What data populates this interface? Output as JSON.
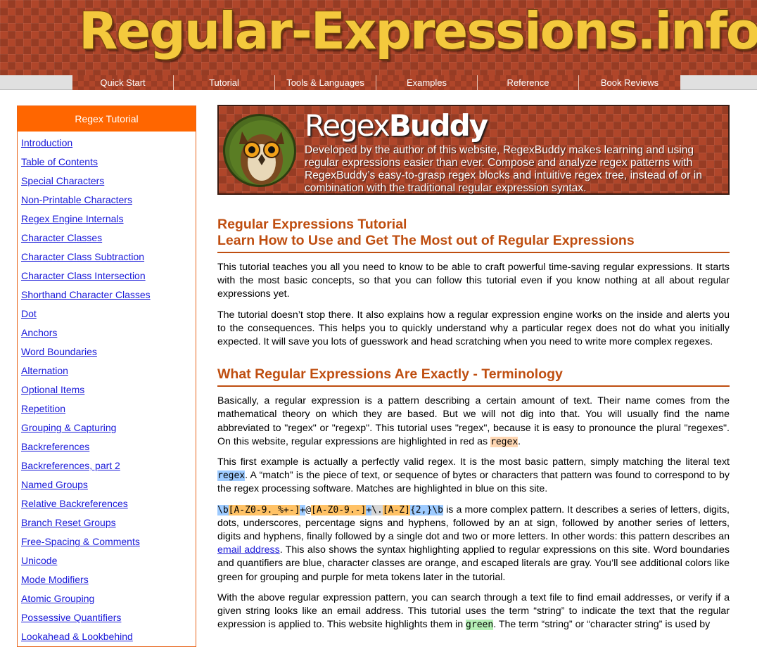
{
  "site": {
    "logo_text": "Regular-Expressions.info"
  },
  "nav": {
    "items": [
      "Quick Start",
      "Tutorial",
      "Tools & Languages",
      "Examples",
      "Reference",
      "Book Reviews"
    ]
  },
  "sidebar": {
    "title": "Regex Tutorial",
    "items": [
      "Introduction",
      "Table of Contents",
      "Special Characters",
      "Non-Printable Characters",
      "Regex Engine Internals",
      "Character Classes",
      "Character Class Subtraction",
      "Character Class Intersection",
      "Shorthand Character Classes",
      "Dot",
      "Anchors",
      "Word Boundaries",
      "Alternation",
      "Optional Items",
      "Repetition",
      "Grouping & Capturing",
      "Backreferences",
      "Backreferences, part 2",
      "Named Groups",
      "Relative Backreferences",
      "Branch Reset Groups",
      "Free-Spacing & Comments",
      "Unicode",
      "Mode Modifiers",
      "Atomic Grouping",
      "Possessive Quantifiers",
      "Lookahead & Lookbehind"
    ]
  },
  "banner": {
    "brand_regex": "Regex",
    "brand_buddy": "Buddy",
    "text": "Developed by the author of this website, RegexBuddy makes learning and using regular expressions easier than ever.  Compose and analyze regex patterns with RegexBuddy’s easy-to-grasp regex blocks and intuitive regex tree, instead of or in combination with the traditional regular expression syntax."
  },
  "main": {
    "title_line1": "Regular Expressions Tutorial",
    "title_line2": "Learn How to Use and Get The Most out of Regular Expressions",
    "p1": "This tutorial teaches you all you need to know to be able to craft powerful time-saving regular expressions. It starts with the most basic concepts, so that you can follow this tutorial even if you know nothing at all about regular expressions yet.",
    "p2": "The tutorial doesn’t stop there. It also explains how a regular expression engine works on the inside and alerts you to the consequences. This helps you to quickly understand why a particular regex does not do what you initially expected. It will save you lots of guesswork and head scratching when you need to write more complex regexes.",
    "h2": "What Regular Expressions Are Exactly - Terminology",
    "p3_text": "Basically, a regular expression is a pattern describing a certain amount of text. Their name comes from the mathematical theory on which they are based. But we will not dig into that. You will usually find the name abbreviated to \"regex\" or \"regexp\". This tutorial uses \"regex\", because it is easy to pronounce the plural \"regexes\". On this website, regular expressions are highlighted in red as ",
    "p3_code": "regex",
    "p3_end": ".",
    "p4_a": "This first example is actually a perfectly valid regex. It is the most basic pattern, simply matching the literal text ",
    "p4_code": "regex",
    "p4_b": ". A “match” is the piece of text, or sequence of bytes or characters that pattern was found to correspond to by the regex processing software. Matches are highlighted in blue on this site.",
    "p5_tokens": [
      {
        "t": "\\b",
        "c": "blue"
      },
      {
        "t": "[A-Z0-9._%+-]",
        "c": "orange"
      },
      {
        "t": "+",
        "c": "blue"
      },
      {
        "t": "@",
        "c": "none"
      },
      {
        "t": "[A-Z0-9.-]",
        "c": "orange"
      },
      {
        "t": "+",
        "c": "blue"
      },
      {
        "t": "\\.",
        "c": "gray"
      },
      {
        "t": "[A-Z]",
        "c": "orange"
      },
      {
        "t": "{2,}",
        "c": "blue"
      },
      {
        "t": "\\b",
        "c": "blue"
      }
    ],
    "p5_a": " is a more complex pattern. It describes a series of letters, digits, dots, underscores, percentage signs and hyphens, followed by an at sign, followed by another series of letters, digits and hyphens, finally followed by a single dot and two or more letters. In other words: this pattern describes an ",
    "p5_link": "email address",
    "p5_b": ". This also shows the syntax highlighting applied to regular expressions on this site. Word boundaries and quantifiers are blue, character classes are orange, and escaped literals are gray. You’ll see additional colors like green for grouping and purple for meta tokens later in the tutorial.",
    "p6_a": "With the above regular expression pattern, you can search through a text file to find email addresses, or verify if a given string looks like an email address. This tutorial uses the term “string” to indicate the text that the regular expression is applied to. This website highlights them in ",
    "p6_code": "green",
    "p6_b": ". The term “string” or “character string” is used by"
  },
  "colors": {
    "accent": "#bf4e10",
    "sidebar_header": "#ff6600",
    "link": "#1a1ad9",
    "regex_red": "#ffd7b3",
    "match_blue": "#9ecbff",
    "string_green": "#b6f0b6",
    "class_orange": "#ffc266",
    "escape_gray": "#d6d6d6"
  }
}
